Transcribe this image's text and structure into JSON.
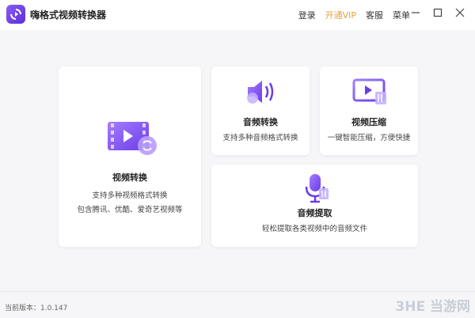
{
  "app": {
    "title": "嗨格式视频转换器"
  },
  "nav": {
    "login": "登录",
    "vip": "开通VIP",
    "service": "客服",
    "menu": "菜单"
  },
  "cards": {
    "video_convert": {
      "title": "视频转换",
      "desc1": "支持多种视频格式转换",
      "desc2": "包含腾讯、优酷、爱奇艺视频等"
    },
    "audio_convert": {
      "title": "音频转换",
      "desc": "支持多种音频格式转换"
    },
    "video_compress": {
      "title": "视频压缩",
      "desc": "一键智能压缩，方便快捷"
    },
    "audio_extract": {
      "title": "音频提取",
      "desc": "轻松提取各类视频中的音频文件"
    }
  },
  "footer": {
    "version": "当前版本：1.0.147",
    "watermark": "3HE 当游网"
  },
  "colors": {
    "accent": "#7c4dff",
    "vip": "#e6a23c"
  },
  "icons": {
    "logo": "app-logo-icon",
    "minimize": "minimize-icon",
    "maximize": "maximize-icon",
    "close": "close-icon",
    "video_convert": "video-convert-icon",
    "audio_convert": "speaker-icon",
    "video_compress": "video-compress-icon",
    "audio_extract": "microphone-icon"
  }
}
